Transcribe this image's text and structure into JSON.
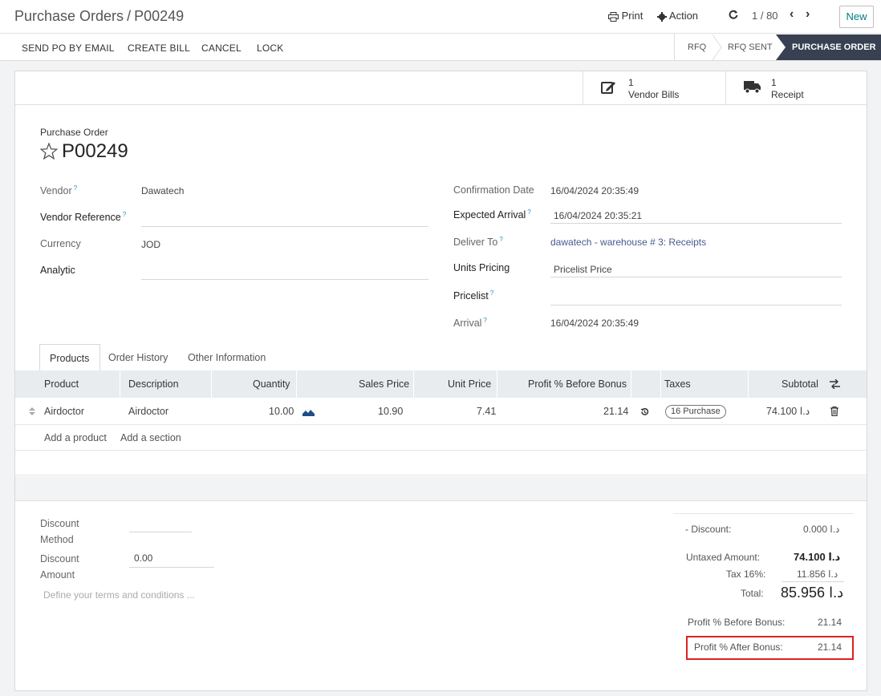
{
  "breadcrumb": {
    "parent": "Purchase Orders",
    "separator": "/",
    "current": "P00249"
  },
  "toolbar": {
    "print": "Print",
    "action": "Action",
    "pager": "1 / 80",
    "new": "New"
  },
  "actions": {
    "send_email": "SEND PO BY EMAIL",
    "create_bill": "CREATE BILL",
    "cancel": "CANCEL",
    "lock": "LOCK"
  },
  "status": {
    "rfq": "RFQ",
    "rfq_sent": "RFQ SENT",
    "purchase_order": "PURCHASE ORDER"
  },
  "smart_buttons": {
    "vendor_bills": {
      "count": "1",
      "label": "Vendor Bills"
    },
    "receipt": {
      "count": "1",
      "label": "Receipt"
    }
  },
  "header": {
    "subtitle": "Purchase Order",
    "title": "P00249"
  },
  "fields_left": {
    "vendor_label": "Vendor",
    "vendor_value": "Dawatech",
    "vendor_ref_label": "Vendor Reference",
    "vendor_ref_value": "",
    "currency_label": "Currency",
    "currency_value": "JOD",
    "analytic_label": "Analytic",
    "analytic_value": ""
  },
  "fields_right": {
    "confirmation_label": "Confirmation Date",
    "confirmation_value": "16/04/2024 20:35:49",
    "expected_label": "Expected Arrival",
    "expected_value": "16/04/2024 20:35:21",
    "deliver_label": "Deliver To",
    "deliver_value": "dawatech - warehouse # 3: Receipts",
    "units_pricing_label": "Units Pricing",
    "units_pricing_value": "Pricelist Price",
    "pricelist_label": "Pricelist",
    "pricelist_value": "",
    "arrival_label": "Arrival",
    "arrival_value": "16/04/2024 20:35:49"
  },
  "tabs": [
    "Products",
    "Order History",
    "Other Information"
  ],
  "table": {
    "headers": [
      "Product",
      "Description",
      "Quantity",
      "Sales Price",
      "Unit Price",
      "Profit % Before Bonus",
      "Taxes",
      "Subtotal"
    ],
    "rows": [
      {
        "product": "Airdoctor",
        "description": "Airdoctor",
        "quantity": "10.00",
        "sales_price": "10.90",
        "unit_price": "7.41",
        "profit_before": "21.14",
        "tax": "16 Purchase",
        "subtotal": "74.100 د.ا"
      }
    ],
    "add_product": "Add a product",
    "add_section": "Add a section"
  },
  "bottom": {
    "discount_method_label_1": "Discount",
    "discount_method_label_2": "Method",
    "discount_amount_label_1": "Discount",
    "discount_amount_label_2": "Amount",
    "discount_amount_value": "0.00",
    "terms_placeholder": "Define your terms and conditions ..."
  },
  "totals": {
    "discount_label": "- Discount:",
    "discount_value": "0.000 د.ا",
    "untaxed_label": "Untaxed Amount:",
    "untaxed_value": "74.100 د.ا",
    "tax_label": "Tax 16%:",
    "tax_value": "11.856 د.ا",
    "total_label": "Total:",
    "total_value": "85.956 د.ا",
    "profit_before_label": "Profit % Before Bonus:",
    "profit_before_value": "21.14",
    "profit_after_label": "Profit % After Bonus:",
    "profit_after_value": "21.14"
  },
  "colors": {
    "accent": "#017e84",
    "stage_active": "#374151",
    "highlight": "#e02020",
    "link": "#475a91"
  }
}
